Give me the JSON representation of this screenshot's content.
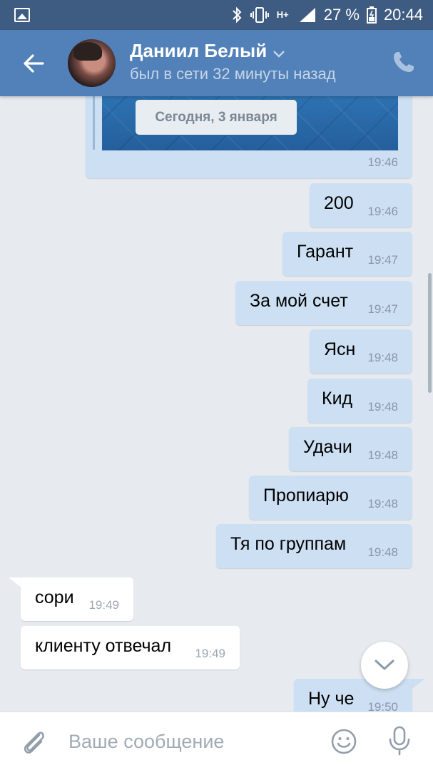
{
  "status_bar": {
    "network_label": "H+",
    "battery_percent": "27 %",
    "time": "20:44"
  },
  "header": {
    "contact_name": "Даниил Белый",
    "last_seen": "был в сети 32 минуты назад"
  },
  "forwarded": {
    "date_label": "Сегодня, 3 января",
    "time": "19:46"
  },
  "messages": [
    {
      "direction": "out",
      "text": "200",
      "time": "19:46"
    },
    {
      "direction": "out",
      "text": "Гарант",
      "time": "19:47"
    },
    {
      "direction": "out",
      "text": "За мой счет",
      "time": "19:47"
    },
    {
      "direction": "out",
      "text": "Ясн",
      "time": "19:48"
    },
    {
      "direction": "out",
      "text": "Кид",
      "time": "19:48"
    },
    {
      "direction": "out",
      "text": "Удачи",
      "time": "19:48"
    },
    {
      "direction": "out",
      "text": "Пропиарю",
      "time": "19:48"
    },
    {
      "direction": "out",
      "text": "Тя по группам",
      "time": "19:48"
    },
    {
      "direction": "in",
      "text": "сори",
      "time": "19:49"
    },
    {
      "direction": "in",
      "text": "клиенту отвечал",
      "time": "19:49"
    },
    {
      "direction": "out",
      "text": "Ну че",
      "time": "19:50"
    }
  ],
  "composer": {
    "placeholder": "Ваше сообщение"
  },
  "colors": {
    "header": "#5181b8",
    "status_bar": "#3e5b81",
    "outgoing_bubble": "#cde0f3",
    "incoming_bubble": "#ffffff",
    "background": "#e7ebf0"
  },
  "icons": {
    "back": "arrow-left-icon",
    "call": "phone-icon",
    "attach": "paperclip-icon",
    "emoji": "smile-icon",
    "voice": "microphone-icon",
    "scroll": "chevron-down-icon"
  }
}
